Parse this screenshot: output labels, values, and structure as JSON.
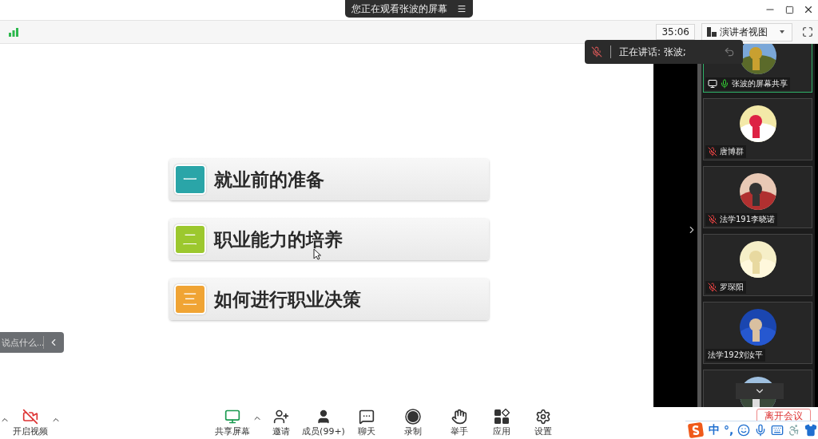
{
  "banner": {
    "text": "您正在观看张波的屏幕"
  },
  "meeting_bar": {
    "timer": "35:06",
    "view_mode": "演讲者视图"
  },
  "speaking": {
    "text": "正在讲话: 张波;"
  },
  "slide": {
    "items": [
      {
        "number": "一",
        "label": "就业前的准备",
        "color": "#2aa5a8"
      },
      {
        "number": "二",
        "label": "职业能力的培养",
        "color": "#9cc82e"
      },
      {
        "number": "三",
        "label": "如何进行职业决策",
        "color": "#f0a434"
      }
    ]
  },
  "chat": {
    "placeholder": "说点什么..."
  },
  "participants": [
    {
      "name": "张波的屏幕共享",
      "kind": "speaking",
      "sharing": true,
      "selected": true
    },
    {
      "name": "唐博群",
      "kind": "muted",
      "sharing": false,
      "selected": false
    },
    {
      "name": "法学191李晓诺",
      "kind": "muted",
      "sharing": false,
      "selected": false
    },
    {
      "name": "罗琛阳",
      "kind": "muted",
      "sharing": false,
      "selected": false
    },
    {
      "name": "法学192刘汝平",
      "kind": "plain",
      "sharing": false,
      "selected": false
    },
    {
      "sharing": false,
      "selected": false
    }
  ],
  "toolbar": {
    "left": [
      {
        "kind": "more"
      },
      {
        "kind": "video",
        "label": "开启视频"
      },
      {
        "kind": "more"
      }
    ],
    "center": [
      {
        "kind": "share",
        "label": "共享屏幕"
      },
      {
        "kind": "more"
      },
      {
        "kind": "invite",
        "label": "邀请"
      },
      {
        "kind": "members",
        "label": "成员(99+)"
      },
      {
        "kind": "chat",
        "label": "聊天"
      },
      {
        "kind": "record",
        "label": "录制"
      },
      {
        "kind": "hand",
        "label": "举手"
      },
      {
        "kind": "apps",
        "label": "应用"
      },
      {
        "kind": "settings",
        "label": "设置"
      }
    ]
  },
  "leave_button": {
    "label": "离开会议"
  },
  "ime": {
    "mode": "中",
    "punctuation": "°,"
  }
}
